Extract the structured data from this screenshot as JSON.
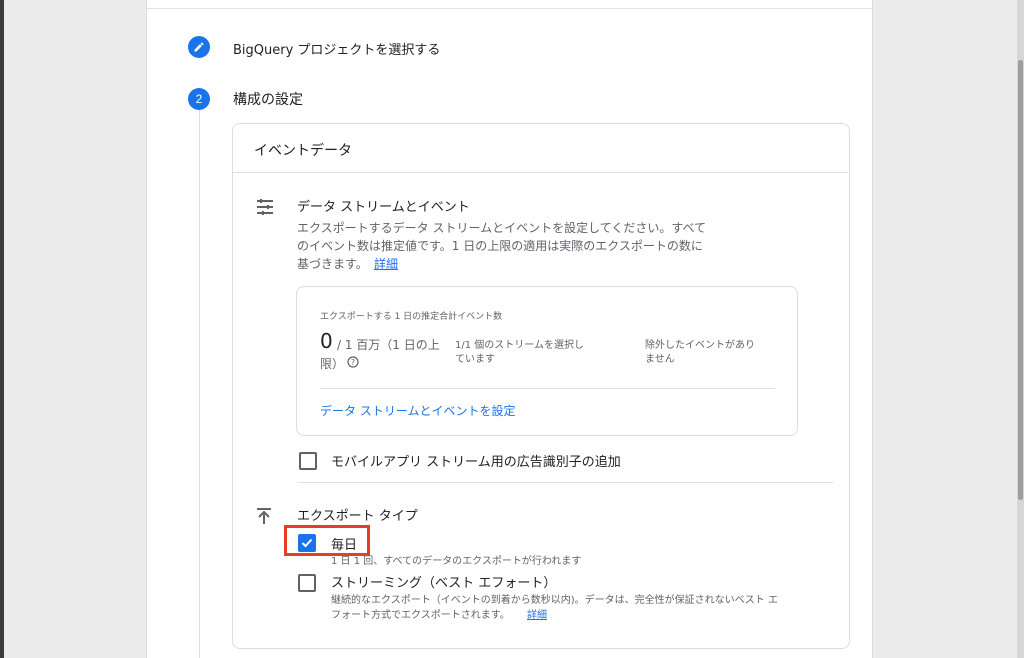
{
  "steps": [
    {
      "label": "BigQuery プロジェクトを選択する",
      "icon": "pencil-icon"
    },
    {
      "number": "2",
      "label": "構成の設定"
    }
  ],
  "card": {
    "title": "イベントデータ",
    "data_streams": {
      "icon": "sliders-icon",
      "heading": "データ ストリームとイベント",
      "description_line1": "エクスポートするデータ ストリームとイベントを設定してください。すべて",
      "description_line2": "のイベント数は推定値です。1 日の上限の適用は実際のエクスポートの数に",
      "description_line3": "基づきます。",
      "details_link": "詳細",
      "summary": {
        "label": "エクスポートする 1 日の推定合計イベント数",
        "count": "0",
        "limit_line1": "/ 1 百万（1 日の上",
        "limit_line2": "限）",
        "help_icon": "help-icon",
        "streams_line1": "1/1 個のストリームを選択し",
        "streams_line2": "ています",
        "excluded_line1": "除外したイベントがあり",
        "excluded_line2": "ません",
        "configure_link": "データ ストリームとイベントを設定"
      },
      "ad_id_checkbox": {
        "label": "モバイルアプリ ストリーム用の広告識別子の追加",
        "checked": false
      }
    },
    "export_type": {
      "icon": "upload-icon",
      "heading": "エクスポート タイプ",
      "daily": {
        "label": "毎日",
        "checked": true,
        "description": "1 日 1 回、すべてのデータのエクスポートが行われます"
      },
      "streaming": {
        "label": "ストリーミング（ベスト エフォート）",
        "checked": false,
        "description_line1": "継続的なエクスポート（イベントの到着から数秒以内)。データは、完全性が保証されないベスト エ",
        "description_line2": "フォート方式でエクスポートされます。",
        "details_link": "詳細"
      }
    }
  },
  "colors": {
    "accent": "#1a73e8",
    "highlight": "#e53e25"
  }
}
